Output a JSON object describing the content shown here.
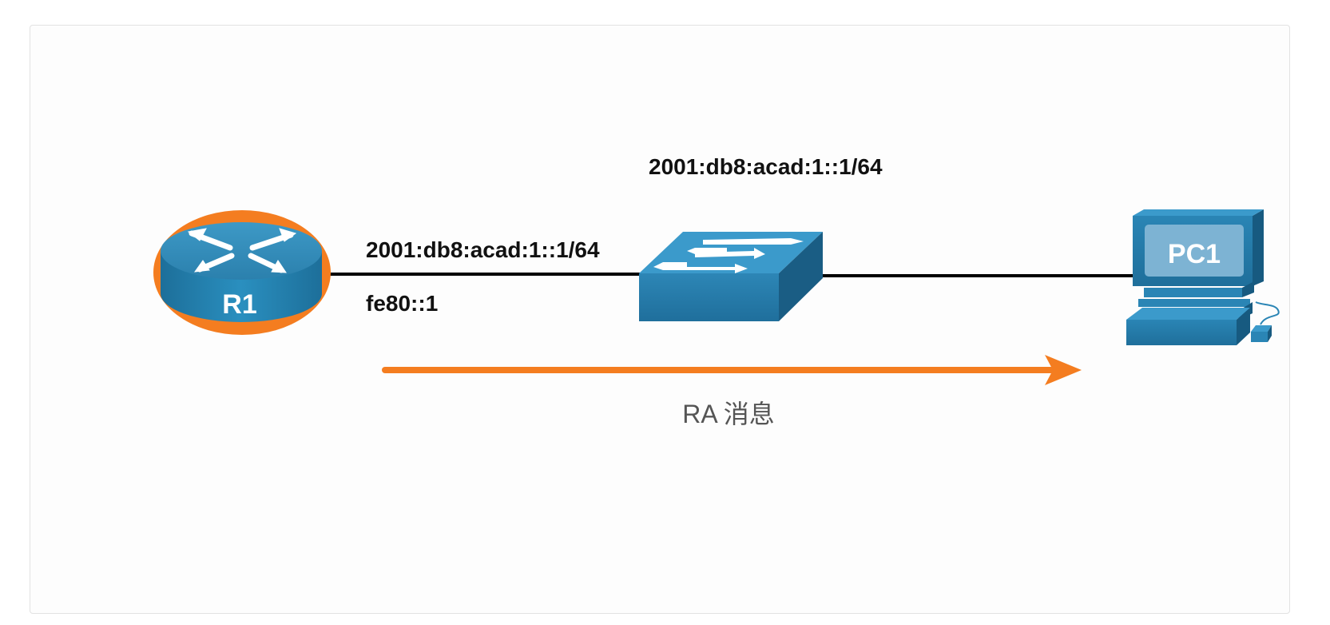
{
  "devices": {
    "router": {
      "label": "R1"
    },
    "pc": {
      "label": "PC1"
    }
  },
  "addresses": {
    "switch_address": "2001:db8:acad:1::1/64",
    "router_global": "2001:db8:acad:1::1/64",
    "router_link_local": "fe80::1"
  },
  "message": {
    "label": "RA 消息"
  },
  "colors": {
    "accent": "#f47d20",
    "device_blue": "#2a7aa6",
    "device_dark": "#1c5f86",
    "link": "#000000",
    "text": "#111111",
    "message_text": "#555555"
  }
}
